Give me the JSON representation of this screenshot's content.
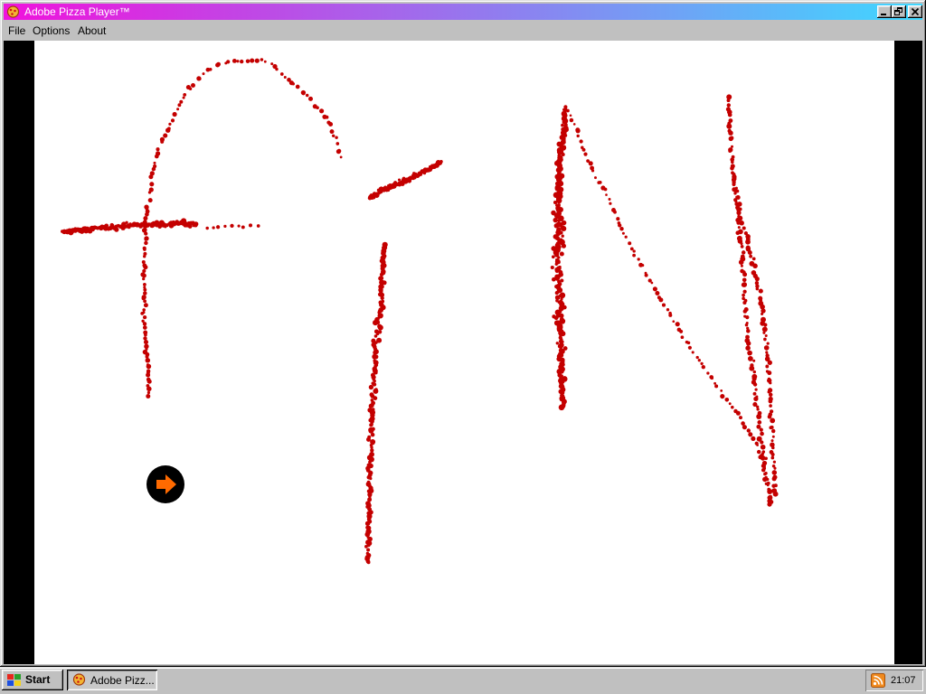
{
  "window": {
    "title": "Adobe Pizza Player™",
    "title_gradient": [
      "#f012dc",
      "#3fd8ff"
    ],
    "app_icon": "pizza-icon",
    "buttons": {
      "minimize": "minimize-icon",
      "restore": "restore-icon",
      "close": "close-icon"
    }
  },
  "menu": {
    "file": "File",
    "options": "Options",
    "about": "About"
  },
  "canvas": {
    "background": "#ffffff",
    "frame_color": "#000000",
    "dot_color": "#c40000",
    "next_button": {
      "icon": "arrow-right-icon",
      "arrow_color": "#ff6a00",
      "circle_color": "#000000"
    }
  },
  "taskbar": {
    "start_icon": "windows-logo-icon",
    "start_label": "Start",
    "task_icon": "pizza-icon",
    "task_label": "Adobe Pizz...",
    "tray_icon": "rss-feed-icon",
    "clock": "21:07"
  }
}
